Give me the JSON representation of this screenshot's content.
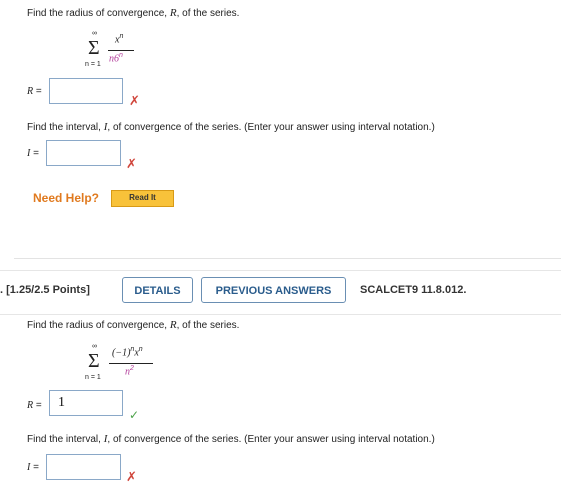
{
  "q1": {
    "radius_prompt_before": "Find the radius of convergence, ",
    "radius_prompt_var": "R",
    "radius_prompt_after": ", of the series.",
    "series": {
      "sum_top": "∞",
      "sum_bottom": "n = 1",
      "numerator": "x",
      "numerator_sup": "n",
      "denominator": "n6",
      "denominator_sup": "n"
    },
    "r_label": "R =",
    "r_value": "",
    "r_status": "✗",
    "interval_prompt_before": "Find the interval, ",
    "interval_prompt_var": "I",
    "interval_prompt_after": ", of convergence of the series. (Enter your answer using interval notation.)",
    "i_label": "I =",
    "i_value": "",
    "i_status": "✗",
    "need_help": "Need Help?",
    "read_it": "Read It"
  },
  "q2_header": {
    "points": ". [1.25/2.5 Points]",
    "details": "DETAILS",
    "previous_answers": "PREVIOUS ANSWERS",
    "code": "SCALCET9 11.8.012."
  },
  "q2": {
    "radius_prompt_before": "Find the radius of convergence, ",
    "radius_prompt_var": "R",
    "radius_prompt_after": ", of the series.",
    "series": {
      "sum_top": "∞",
      "sum_bottom": "n = 1",
      "numerator": "(−1)",
      "numerator_sup": "n",
      "numerator_tail": "x",
      "numerator_tail_sup": "n",
      "denominator": "n",
      "denominator_sup": "2"
    },
    "r_label": "R =",
    "r_value": "1",
    "r_status": "✓",
    "interval_prompt_before": "Find the interval, ",
    "interval_prompt_var": "I",
    "interval_prompt_after": ", of convergence of the series. (Enter your answer using interval notation.)",
    "i_label": "I =",
    "i_value": "",
    "i_status": "✗"
  }
}
